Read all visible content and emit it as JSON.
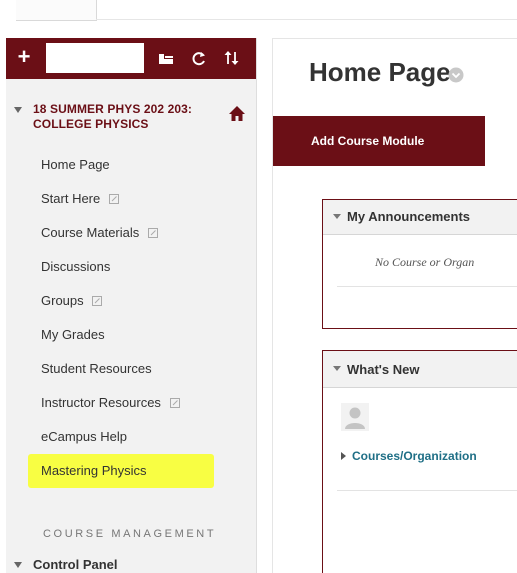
{
  "course_menu": {
    "search_placeholder": "",
    "course_title": "18 SUMMER PHYS 202 203: COLLEGE PHYSICS",
    "items": [
      {
        "label": "Home Page"
      },
      {
        "label": "Start Here"
      },
      {
        "label": "Course Materials"
      },
      {
        "label": "Discussions"
      },
      {
        "label": "Groups"
      },
      {
        "label": "My Grades"
      },
      {
        "label": "Student Resources"
      },
      {
        "label": "Instructor Resources"
      },
      {
        "label": "eCampus Help"
      },
      {
        "label": "Mastering Physics"
      }
    ],
    "course_management_label": "COURSE MANAGEMENT",
    "control_panel_label": "Control Panel"
  },
  "main": {
    "page_title": "Home Page",
    "add_module_label": "Add Course Module",
    "modules": {
      "announcements": {
        "title": "My Announcements",
        "empty_text": "No Course or Organ"
      },
      "whats_new": {
        "title": "What's New",
        "link_text": "Courses/Organization"
      }
    }
  },
  "colors": {
    "brand": "#6b0f16",
    "link": "#1f6f86",
    "highlight": "#f8ff34"
  },
  "icons": {
    "add": "plus-icon",
    "folder_view": "folder-view-icon",
    "refresh": "refresh-icon",
    "sort": "sort-arrows-icon",
    "home": "home-icon",
    "external": "external-link-icon",
    "avatar": "user-avatar-icon"
  }
}
